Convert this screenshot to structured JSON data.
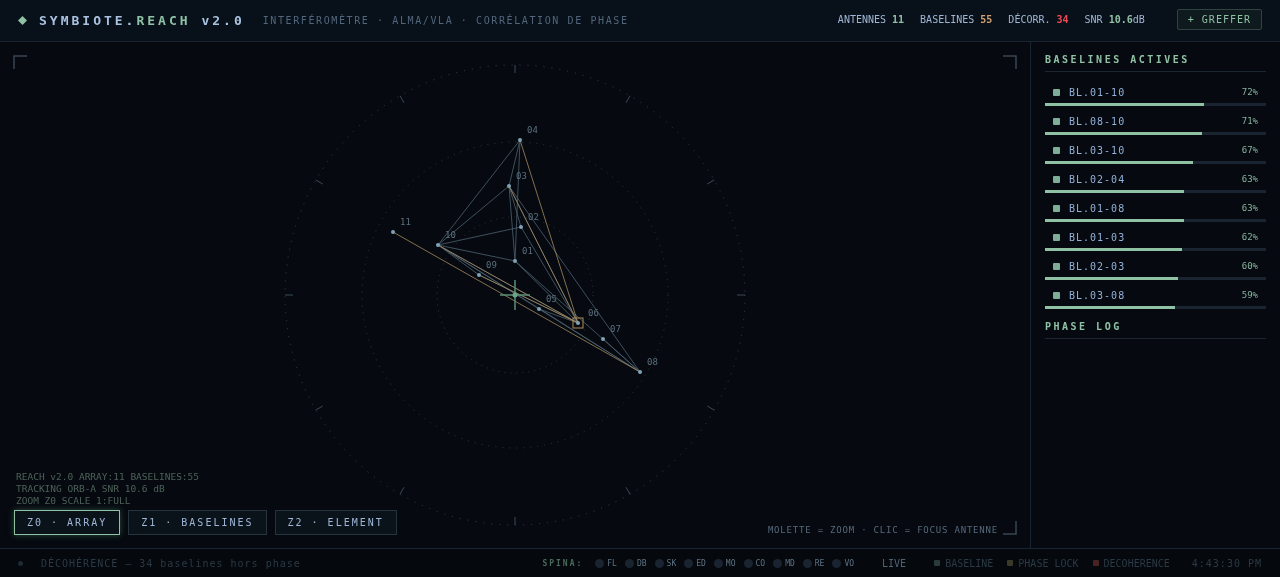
{
  "header": {
    "title_prefix": "SYMBIOTE.",
    "title_accent": "REACH",
    "version": "v2.0",
    "subtitle": "INTERFÉROMÈTRE · ALMA/VLA · CORRÉLATION DE PHASE",
    "stats": [
      {
        "label": "ANTENNES",
        "value": "11",
        "kind": "ok"
      },
      {
        "label": "BASELINES",
        "value": "55",
        "kind": "warn"
      },
      {
        "label": "DÉCORR.",
        "value": "34",
        "kind": "alert"
      },
      {
        "label": "SNR",
        "value": "10.6",
        "unit": "dB",
        "kind": "ok"
      }
    ],
    "action": "+ GREFFER"
  },
  "array_view": {
    "antennas": [
      {
        "label": "04"
      },
      {
        "label": "03"
      },
      {
        "label": "02"
      },
      {
        "label": "01"
      },
      {
        "label": "10"
      },
      {
        "label": "11"
      },
      {
        "label": "09"
      },
      {
        "label": "05"
      },
      {
        "label": "06",
        "focused": true
      },
      {
        "label": "07"
      },
      {
        "label": "08"
      }
    ],
    "overlay_lines": [
      "REACH v2.0  ARRAY:11  BASELINES:55",
      "TRACKING ORB-A  SNR 10.6 dB",
      "ZOOM Z0  SCALE 1:FULL"
    ],
    "zoom_tabs": [
      {
        "label": "Z0 · ARRAY",
        "selected": true
      },
      {
        "label": "Z1 · BASELINES",
        "selected": false
      },
      {
        "label": "Z2 · ELEMENT",
        "selected": false
      }
    ],
    "hint": "MOLETTE = ZOOM · CLIC = FOCUS ANTENNE"
  },
  "sidebar": {
    "title": "BASELINES ACTIVES",
    "baselines": [
      {
        "name": "BL.01-10",
        "reading": "72%",
        "level": 0.72
      },
      {
        "name": "BL.08-10",
        "reading": "71%",
        "level": 0.71
      },
      {
        "name": "BL.03-10",
        "reading": "67%",
        "level": 0.67
      },
      {
        "name": "BL.02-04",
        "reading": "63%",
        "level": 0.63
      },
      {
        "name": "BL.01-08",
        "reading": "63%",
        "level": 0.63
      },
      {
        "name": "BL.01-03",
        "reading": "62%",
        "level": 0.62
      },
      {
        "name": "BL.02-03",
        "reading": "60%",
        "level": 0.6
      },
      {
        "name": "BL.03-08",
        "reading": "59%",
        "level": 0.59
      }
    ],
    "log_title": "PHASE LOG"
  },
  "status_bar": {
    "message": "DÉCOHÉRENCE — 34 baselines hors phase",
    "spina_label": "SPINA:",
    "spina": [
      "FL",
      "DB",
      "SK",
      "ED",
      "MO",
      "CO",
      "MD",
      "RE",
      "VO"
    ],
    "live": "LIVE",
    "legend": [
      {
        "label": "BASELINE",
        "color": "#2b3a3c"
      },
      {
        "label": "PHASE LOCK",
        "color": "#3a3828"
      },
      {
        "label": "DECOHERENCE",
        "color": "#4a2224"
      }
    ],
    "time": "4:43:30 PM"
  }
}
